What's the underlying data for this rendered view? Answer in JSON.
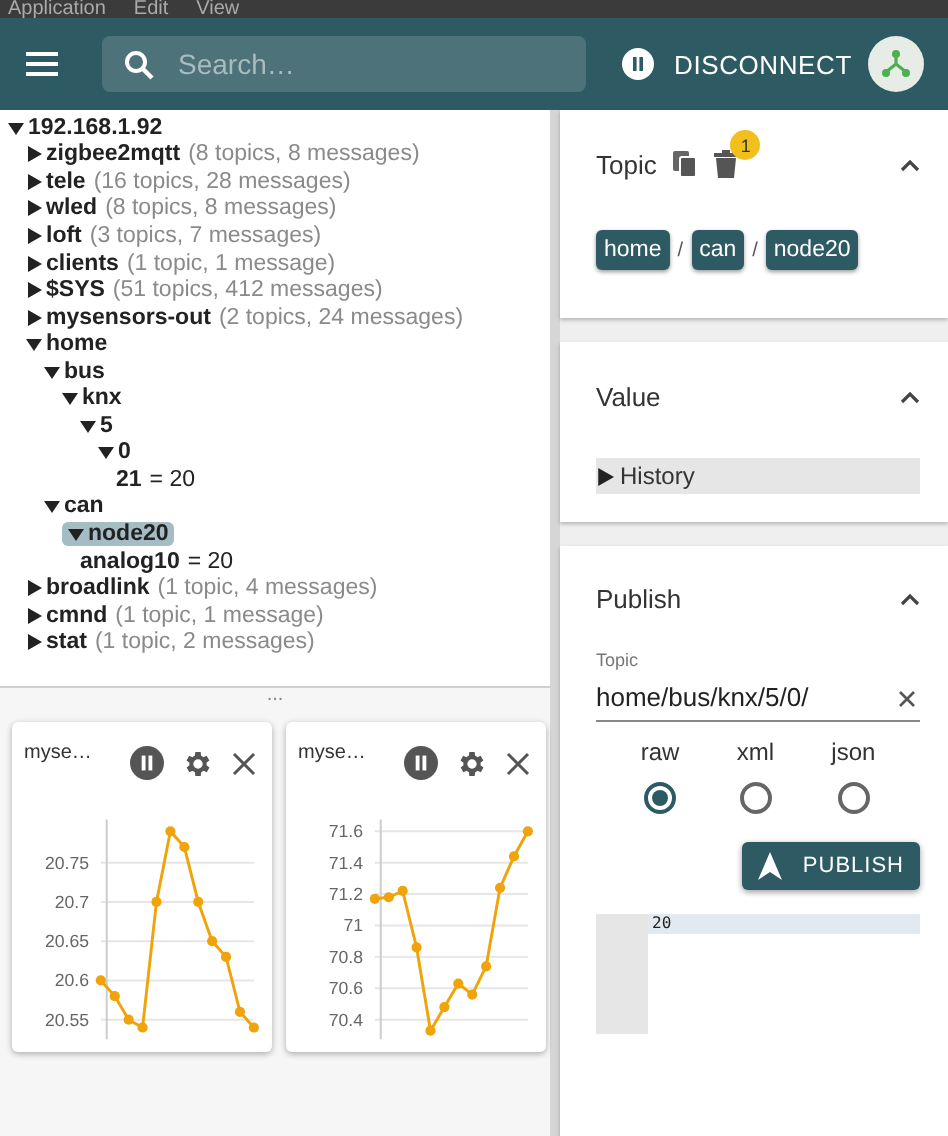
{
  "menu_bar": {
    "items": [
      "Application",
      "Edit",
      "View"
    ]
  },
  "app_bar": {
    "search": {
      "placeholder": "Search…"
    },
    "paused": true,
    "disconnect_label": "DISCONNECT"
  },
  "tree": {
    "name": "192.168.1.92",
    "expanded": true,
    "selected": false,
    "children": [
      {
        "name": "zigbee2mqtt",
        "summary": "(8 topics, 8 messages)",
        "expanded": false,
        "selected": false
      },
      {
        "name": "tele",
        "summary": "(16 topics, 28 messages)",
        "expanded": false,
        "selected": false
      },
      {
        "name": "wled",
        "summary": "(8 topics, 8 messages)",
        "expanded": false,
        "selected": false
      },
      {
        "name": "loft",
        "summary": "(3 topics, 7 messages)",
        "expanded": false,
        "selected": false
      },
      {
        "name": "clients",
        "summary": "(1 topic, 1 message)",
        "expanded": false,
        "selected": false
      },
      {
        "name": "$SYS",
        "summary": "(51 topics, 412 messages)",
        "expanded": false,
        "selected": false
      },
      {
        "name": "mysensors-out",
        "summary": "(2 topics, 24 messages)",
        "expanded": false,
        "selected": false
      },
      {
        "name": "home",
        "expanded": true,
        "selected": false,
        "children": [
          {
            "name": "bus",
            "expanded": true,
            "selected": false,
            "children": [
              {
                "name": "knx",
                "expanded": true,
                "selected": false,
                "children": [
                  {
                    "name": "5",
                    "expanded": true,
                    "selected": false,
                    "children": [
                      {
                        "name": "0",
                        "expanded": true,
                        "selected": false,
                        "children": [
                          {
                            "name": "21",
                            "equals": "=",
                            "value": "20",
                            "selected": false
                          }
                        ]
                      }
                    ]
                  }
                ]
              }
            ]
          },
          {
            "name": "can",
            "expanded": true,
            "selected": false,
            "children": [
              {
                "name": "node20",
                "expanded": true,
                "selected": true,
                "children": [
                  {
                    "name": "analog10",
                    "equals": "=",
                    "value": "20",
                    "selected": false
                  }
                ]
              }
            ]
          }
        ]
      },
      {
        "name": "broadlink",
        "summary": "(1 topic, 4 messages)",
        "expanded": false,
        "selected": false
      },
      {
        "name": "cmnd",
        "summary": "(1 topic, 1 message)",
        "expanded": false,
        "selected": false
      },
      {
        "name": "stat",
        "summary": "(1 topic, 2 messages)",
        "expanded": false,
        "selected": false
      }
    ]
  },
  "splitter_handle": "...",
  "charts": [
    {
      "title": "myse…",
      "paused": true,
      "chart_data": {
        "type": "line",
        "ylim": [
          20.53,
          20.8
        ],
        "yticks": [
          {
            "value": 20.55,
            "label": "20.55"
          },
          {
            "value": 20.6,
            "label": "20.6"
          },
          {
            "value": 20.65,
            "label": "20.65"
          },
          {
            "value": 20.7,
            "label": "20.7"
          },
          {
            "value": 20.75,
            "label": "20.75"
          }
        ],
        "grid": true,
        "series": [
          {
            "color": "#f0a30a",
            "marker": true,
            "values": [
              20.6,
              20.58,
              20.55,
              20.54,
              20.7,
              20.79,
              20.77,
              20.7,
              20.65,
              20.63,
              20.56,
              20.54
            ]
          }
        ]
      }
    },
    {
      "title": "myse…",
      "paused": true,
      "chart_data": {
        "type": "line",
        "ylim": [
          70.3,
          71.65
        ],
        "yticks": [
          {
            "value": 70.4,
            "label": "70.4"
          },
          {
            "value": 70.6,
            "label": "70.6"
          },
          {
            "value": 70.8,
            "label": "70.8"
          },
          {
            "value": 71,
            "label": "71"
          },
          {
            "value": 71.2,
            "label": "71.2"
          },
          {
            "value": 71.4,
            "label": "71.4"
          },
          {
            "value": 71.6,
            "label": "71.6"
          }
        ],
        "grid": true,
        "series": [
          {
            "color": "#f0a30a",
            "marker": true,
            "values": [
              71.17,
              71.18,
              71.22,
              70.86,
              70.33,
              70.48,
              70.63,
              70.56,
              70.74,
              71.24,
              71.44,
              71.6
            ]
          }
        ]
      }
    }
  ],
  "topic_panel": {
    "title": "Topic",
    "expanded": true,
    "delete_badge": "1",
    "path": [
      "home",
      "can",
      "node20"
    ],
    "separator": "/"
  },
  "value_panel": {
    "title": "Value",
    "expanded": true,
    "history": {
      "label": "History",
      "expanded": false
    }
  },
  "publish_panel": {
    "title": "Publish",
    "expanded": true,
    "topic_label": "Topic",
    "topic_value": "home/bus/knx/5/0/",
    "formats": [
      {
        "label": "raw",
        "selected": true
      },
      {
        "label": "xml",
        "selected": false
      },
      {
        "label": "json",
        "selected": false
      }
    ],
    "publish_label": "PUBLISH",
    "editor_lines": [
      "20"
    ]
  }
}
